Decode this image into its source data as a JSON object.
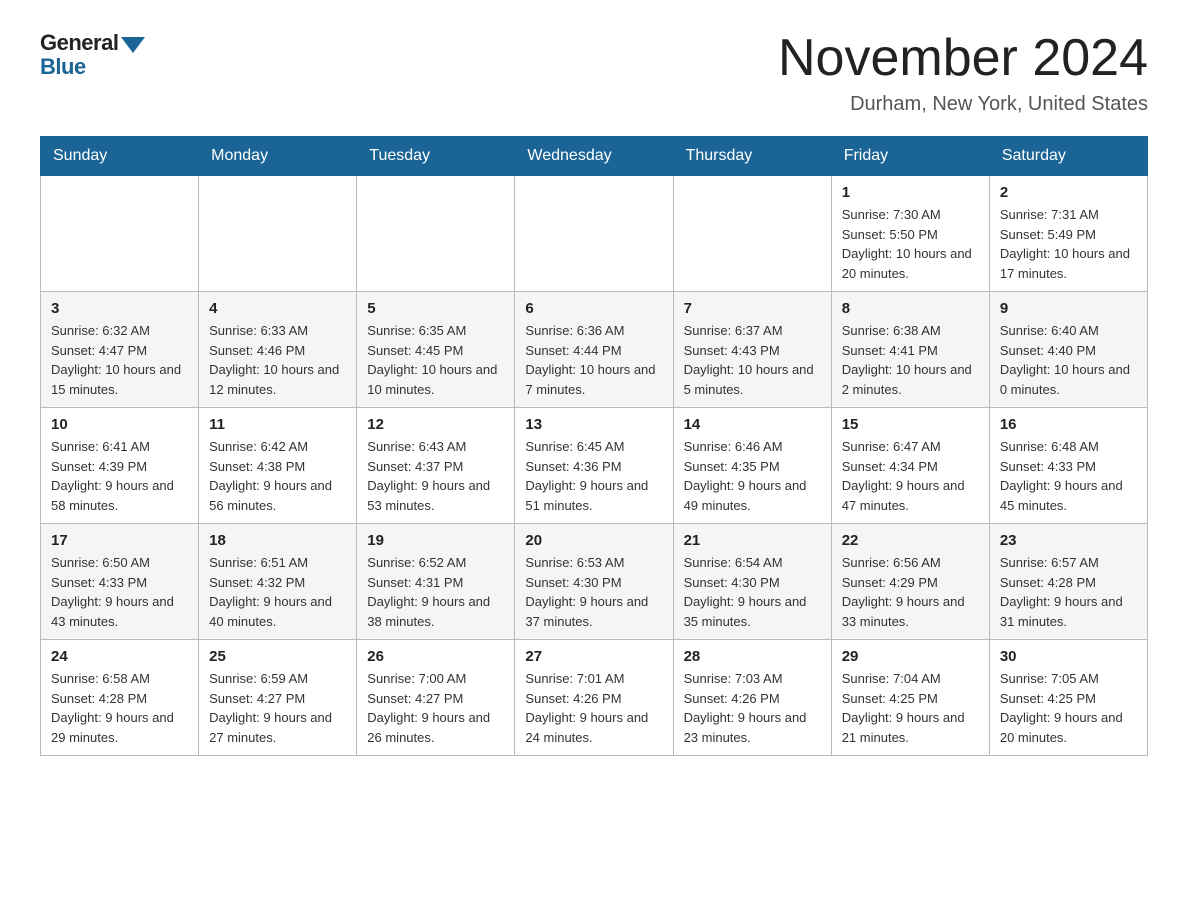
{
  "header": {
    "logo_general": "General",
    "logo_blue": "Blue",
    "month_title": "November 2024",
    "location": "Durham, New York, United States"
  },
  "days_of_week": [
    "Sunday",
    "Monday",
    "Tuesday",
    "Wednesday",
    "Thursday",
    "Friday",
    "Saturday"
  ],
  "weeks": [
    [
      {
        "day": "",
        "sunrise": "",
        "sunset": "",
        "daylight": ""
      },
      {
        "day": "",
        "sunrise": "",
        "sunset": "",
        "daylight": ""
      },
      {
        "day": "",
        "sunrise": "",
        "sunset": "",
        "daylight": ""
      },
      {
        "day": "",
        "sunrise": "",
        "sunset": "",
        "daylight": ""
      },
      {
        "day": "",
        "sunrise": "",
        "sunset": "",
        "daylight": ""
      },
      {
        "day": "1",
        "sunrise": "Sunrise: 7:30 AM",
        "sunset": "Sunset: 5:50 PM",
        "daylight": "Daylight: 10 hours and 20 minutes."
      },
      {
        "day": "2",
        "sunrise": "Sunrise: 7:31 AM",
        "sunset": "Sunset: 5:49 PM",
        "daylight": "Daylight: 10 hours and 17 minutes."
      }
    ],
    [
      {
        "day": "3",
        "sunrise": "Sunrise: 6:32 AM",
        "sunset": "Sunset: 4:47 PM",
        "daylight": "Daylight: 10 hours and 15 minutes."
      },
      {
        "day": "4",
        "sunrise": "Sunrise: 6:33 AM",
        "sunset": "Sunset: 4:46 PM",
        "daylight": "Daylight: 10 hours and 12 minutes."
      },
      {
        "day": "5",
        "sunrise": "Sunrise: 6:35 AM",
        "sunset": "Sunset: 4:45 PM",
        "daylight": "Daylight: 10 hours and 10 minutes."
      },
      {
        "day": "6",
        "sunrise": "Sunrise: 6:36 AM",
        "sunset": "Sunset: 4:44 PM",
        "daylight": "Daylight: 10 hours and 7 minutes."
      },
      {
        "day": "7",
        "sunrise": "Sunrise: 6:37 AM",
        "sunset": "Sunset: 4:43 PM",
        "daylight": "Daylight: 10 hours and 5 minutes."
      },
      {
        "day": "8",
        "sunrise": "Sunrise: 6:38 AM",
        "sunset": "Sunset: 4:41 PM",
        "daylight": "Daylight: 10 hours and 2 minutes."
      },
      {
        "day": "9",
        "sunrise": "Sunrise: 6:40 AM",
        "sunset": "Sunset: 4:40 PM",
        "daylight": "Daylight: 10 hours and 0 minutes."
      }
    ],
    [
      {
        "day": "10",
        "sunrise": "Sunrise: 6:41 AM",
        "sunset": "Sunset: 4:39 PM",
        "daylight": "Daylight: 9 hours and 58 minutes."
      },
      {
        "day": "11",
        "sunrise": "Sunrise: 6:42 AM",
        "sunset": "Sunset: 4:38 PM",
        "daylight": "Daylight: 9 hours and 56 minutes."
      },
      {
        "day": "12",
        "sunrise": "Sunrise: 6:43 AM",
        "sunset": "Sunset: 4:37 PM",
        "daylight": "Daylight: 9 hours and 53 minutes."
      },
      {
        "day": "13",
        "sunrise": "Sunrise: 6:45 AM",
        "sunset": "Sunset: 4:36 PM",
        "daylight": "Daylight: 9 hours and 51 minutes."
      },
      {
        "day": "14",
        "sunrise": "Sunrise: 6:46 AM",
        "sunset": "Sunset: 4:35 PM",
        "daylight": "Daylight: 9 hours and 49 minutes."
      },
      {
        "day": "15",
        "sunrise": "Sunrise: 6:47 AM",
        "sunset": "Sunset: 4:34 PM",
        "daylight": "Daylight: 9 hours and 47 minutes."
      },
      {
        "day": "16",
        "sunrise": "Sunrise: 6:48 AM",
        "sunset": "Sunset: 4:33 PM",
        "daylight": "Daylight: 9 hours and 45 minutes."
      }
    ],
    [
      {
        "day": "17",
        "sunrise": "Sunrise: 6:50 AM",
        "sunset": "Sunset: 4:33 PM",
        "daylight": "Daylight: 9 hours and 43 minutes."
      },
      {
        "day": "18",
        "sunrise": "Sunrise: 6:51 AM",
        "sunset": "Sunset: 4:32 PM",
        "daylight": "Daylight: 9 hours and 40 minutes."
      },
      {
        "day": "19",
        "sunrise": "Sunrise: 6:52 AM",
        "sunset": "Sunset: 4:31 PM",
        "daylight": "Daylight: 9 hours and 38 minutes."
      },
      {
        "day": "20",
        "sunrise": "Sunrise: 6:53 AM",
        "sunset": "Sunset: 4:30 PM",
        "daylight": "Daylight: 9 hours and 37 minutes."
      },
      {
        "day": "21",
        "sunrise": "Sunrise: 6:54 AM",
        "sunset": "Sunset: 4:30 PM",
        "daylight": "Daylight: 9 hours and 35 minutes."
      },
      {
        "day": "22",
        "sunrise": "Sunrise: 6:56 AM",
        "sunset": "Sunset: 4:29 PM",
        "daylight": "Daylight: 9 hours and 33 minutes."
      },
      {
        "day": "23",
        "sunrise": "Sunrise: 6:57 AM",
        "sunset": "Sunset: 4:28 PM",
        "daylight": "Daylight: 9 hours and 31 minutes."
      }
    ],
    [
      {
        "day": "24",
        "sunrise": "Sunrise: 6:58 AM",
        "sunset": "Sunset: 4:28 PM",
        "daylight": "Daylight: 9 hours and 29 minutes."
      },
      {
        "day": "25",
        "sunrise": "Sunrise: 6:59 AM",
        "sunset": "Sunset: 4:27 PM",
        "daylight": "Daylight: 9 hours and 27 minutes."
      },
      {
        "day": "26",
        "sunrise": "Sunrise: 7:00 AM",
        "sunset": "Sunset: 4:27 PM",
        "daylight": "Daylight: 9 hours and 26 minutes."
      },
      {
        "day": "27",
        "sunrise": "Sunrise: 7:01 AM",
        "sunset": "Sunset: 4:26 PM",
        "daylight": "Daylight: 9 hours and 24 minutes."
      },
      {
        "day": "28",
        "sunrise": "Sunrise: 7:03 AM",
        "sunset": "Sunset: 4:26 PM",
        "daylight": "Daylight: 9 hours and 23 minutes."
      },
      {
        "day": "29",
        "sunrise": "Sunrise: 7:04 AM",
        "sunset": "Sunset: 4:25 PM",
        "daylight": "Daylight: 9 hours and 21 minutes."
      },
      {
        "day": "30",
        "sunrise": "Sunrise: 7:05 AM",
        "sunset": "Sunset: 4:25 PM",
        "daylight": "Daylight: 9 hours and 20 minutes."
      }
    ]
  ]
}
